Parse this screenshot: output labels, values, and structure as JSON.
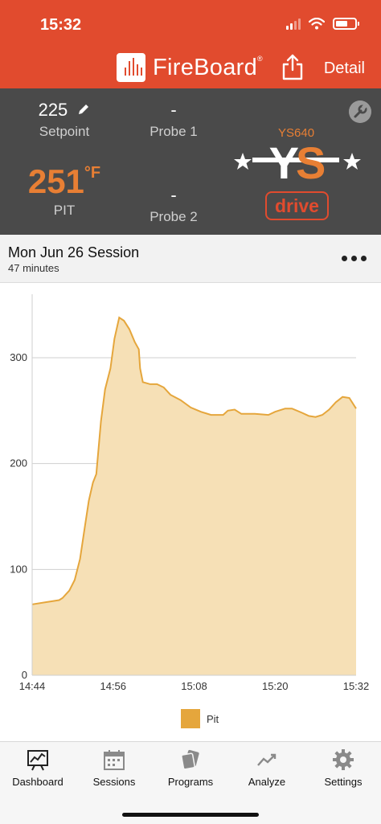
{
  "status": {
    "time": "15:32"
  },
  "nav": {
    "brand": "FireBoard",
    "reg": "®",
    "detail_label": "Detail"
  },
  "probes": {
    "setpoint": {
      "value": "225",
      "label": "Setpoint"
    },
    "probe1": {
      "value": "-",
      "label": "Probe 1"
    },
    "pit": {
      "value": "251",
      "unit": "°F",
      "label": "PIT"
    },
    "probe2": {
      "value": "-",
      "label": "Probe 2"
    },
    "controller": {
      "model": "YS640",
      "logo_text": "YS",
      "drive_label": "drive"
    }
  },
  "session": {
    "title": "Mon Jun 26 Session",
    "duration": "47 minutes"
  },
  "chart_data": {
    "type": "area",
    "x_ticks": [
      "14:44",
      "14:56",
      "15:08",
      "15:20",
      "15:32"
    ],
    "y_ticks": [
      0,
      100,
      200,
      300
    ],
    "ylim": [
      0,
      360
    ],
    "xlim_minutes": [
      0,
      48
    ],
    "grid": true,
    "legend_placement": "bottom",
    "series": [
      {
        "name": "Pit",
        "color": "#e5a63c",
        "fill": "#f6e0b6",
        "points": [
          [
            0,
            67
          ],
          [
            2,
            69
          ],
          [
            4,
            71
          ],
          [
            4.5,
            73
          ],
          [
            5.5,
            80
          ],
          [
            6.3,
            90
          ],
          [
            7.1,
            110
          ],
          [
            7.8,
            140
          ],
          [
            8.4,
            165
          ],
          [
            9,
            182
          ],
          [
            9.5,
            190
          ],
          [
            10.2,
            240
          ],
          [
            10.8,
            270
          ],
          [
            11.6,
            290
          ],
          [
            12.2,
            318
          ],
          [
            12.9,
            338
          ],
          [
            13.6,
            335
          ],
          [
            14.4,
            327
          ],
          [
            15.2,
            315
          ],
          [
            15.8,
            308
          ],
          [
            16,
            290
          ],
          [
            16.4,
            277
          ],
          [
            17.5,
            275
          ],
          [
            18.5,
            275
          ],
          [
            19.5,
            272
          ],
          [
            20.5,
            265
          ],
          [
            22,
            260
          ],
          [
            23.5,
            253
          ],
          [
            25,
            249
          ],
          [
            26.5,
            246
          ],
          [
            27.5,
            246
          ],
          [
            28.3,
            246
          ],
          [
            29,
            250
          ],
          [
            30,
            251
          ],
          [
            31,
            247
          ],
          [
            33,
            247
          ],
          [
            35,
            246
          ],
          [
            36,
            249
          ],
          [
            37.5,
            252
          ],
          [
            38.5,
            252
          ],
          [
            40,
            248
          ],
          [
            41,
            245
          ],
          [
            42,
            244
          ],
          [
            43,
            246
          ],
          [
            44,
            251
          ],
          [
            45,
            258
          ],
          [
            46,
            263
          ],
          [
            47,
            262
          ],
          [
            48,
            252
          ]
        ]
      }
    ]
  },
  "tabs": [
    {
      "label": "Dashboard",
      "icon": "dashboard-icon"
    },
    {
      "label": "Sessions",
      "icon": "calendar-icon"
    },
    {
      "label": "Programs",
      "icon": "cards-icon"
    },
    {
      "label": "Analyze",
      "icon": "trend-icon"
    },
    {
      "label": "Settings",
      "icon": "gear-icon"
    }
  ],
  "colors": {
    "header": "#e14b2e",
    "panel": "#4a4a4a",
    "accent": "#e87f34"
  }
}
